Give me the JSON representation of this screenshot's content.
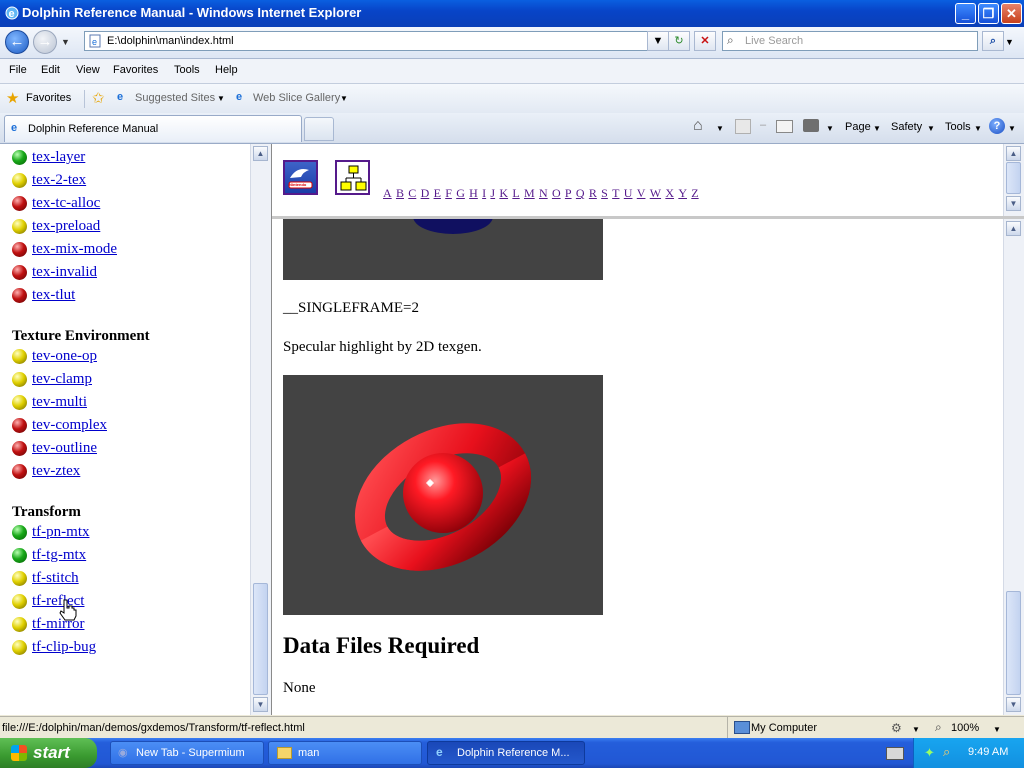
{
  "window": {
    "title": "Dolphin Reference Manual - Windows Internet Explorer"
  },
  "address": {
    "url": "E:\\dolphin\\man\\index.html"
  },
  "search": {
    "placeholder": "Live Search"
  },
  "menu": [
    "File",
    "Edit",
    "View",
    "Favorites",
    "Tools",
    "Help"
  ],
  "favorites_bar": {
    "favorites": "Favorites",
    "suggested": "Suggested Sites",
    "webslice": "Web Slice Gallery"
  },
  "tab": {
    "title": "Dolphin Reference Manual"
  },
  "command_bar": {
    "page": "Page",
    "safety": "Safety",
    "tools": "Tools"
  },
  "sidebar": {
    "items_top": [
      {
        "label": "tex-layer",
        "status": "green"
      },
      {
        "label": "tex-2-tex",
        "status": "yellow"
      },
      {
        "label": "tex-tc-alloc",
        "status": "red"
      },
      {
        "label": "tex-preload",
        "status": "yellow"
      },
      {
        "label": "tex-mix-mode",
        "status": "red"
      },
      {
        "label": "tex-invalid",
        "status": "red"
      },
      {
        "label": "tex-tlut",
        "status": "red"
      }
    ],
    "section_texenv": "Texture Environment",
    "items_texenv": [
      {
        "label": "tev-one-op",
        "status": "yellow"
      },
      {
        "label": "tev-clamp",
        "status": "yellow"
      },
      {
        "label": "tev-multi",
        "status": "yellow"
      },
      {
        "label": "tev-complex",
        "status": "red"
      },
      {
        "label": "tev-outline",
        "status": "red"
      },
      {
        "label": "tev-ztex",
        "status": "red"
      }
    ],
    "section_transform": "Transform",
    "items_transform": [
      {
        "label": "tf-pn-mtx",
        "status": "green"
      },
      {
        "label": "tf-tg-mtx",
        "status": "green"
      },
      {
        "label": "tf-stitch",
        "status": "yellow"
      },
      {
        "label": "tf-reflect",
        "status": "yellow"
      },
      {
        "label": "tf-mirror",
        "status": "yellow"
      },
      {
        "label": "tf-clip-bug",
        "status": "yellow"
      }
    ]
  },
  "topframe": {
    "logo_text": "Nintendo",
    "alphabet": [
      "A",
      "B",
      "C",
      "D",
      "E",
      "F",
      "G",
      "H",
      "I",
      "J",
      "K",
      "L",
      "M",
      "N",
      "O",
      "P",
      "Q",
      "R",
      "S",
      "T",
      "U",
      "V",
      "W",
      "X",
      "Y",
      "Z"
    ]
  },
  "main": {
    "singleframe": "__SINGLEFRAME=2",
    "caption": "Specular highlight by 2D texgen.",
    "heading": "Data Files Required",
    "body": "None"
  },
  "status": {
    "url": "file:///E:/dolphin/man/demos/gxdemos/Transform/tf-reflect.html",
    "zone": "My Computer",
    "zoom": "100%"
  },
  "taskbar": {
    "start": "start",
    "tasks": [
      "New Tab - Supermium",
      "man",
      "Dolphin Reference M..."
    ],
    "clock": "9:49 AM"
  },
  "colors": {
    "link": "#0000cc",
    "visited": "#551a8b",
    "render_bg": "#434343",
    "torus": "#e8101c"
  }
}
